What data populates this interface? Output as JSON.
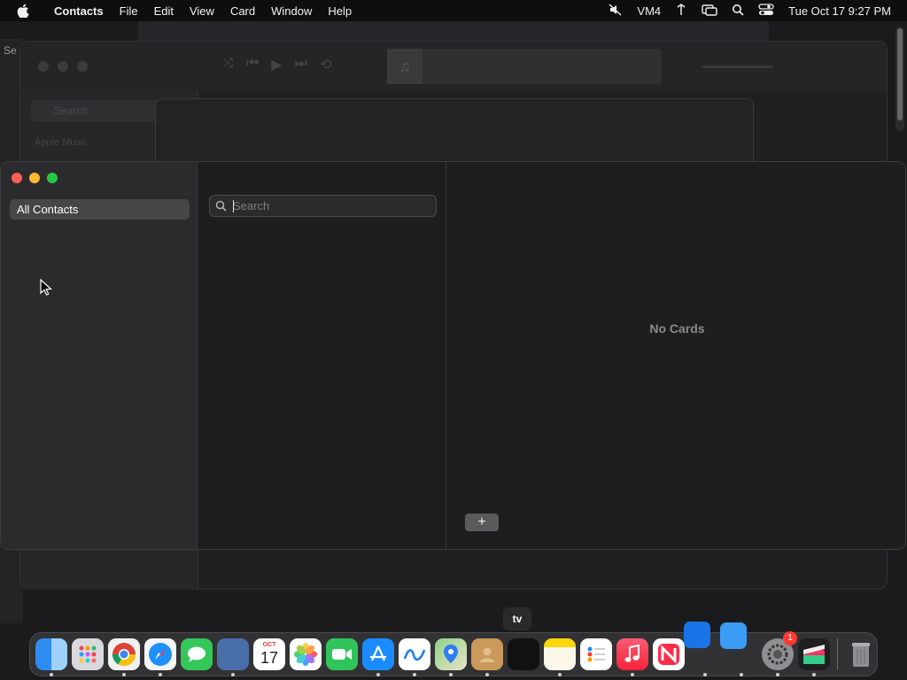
{
  "menubar": {
    "app_name": "Contacts",
    "items": [
      "File",
      "Edit",
      "View",
      "Card",
      "Window",
      "Help"
    ],
    "status_text": "VM4",
    "clock": "Tue Oct 17  9:27 PM"
  },
  "background": {
    "left_window_text": "Se",
    "music_search_placeholder": "Search",
    "music_section": "Apple Music"
  },
  "contacts": {
    "groups": [
      {
        "label": "All Contacts",
        "selected": true
      }
    ],
    "search": {
      "placeholder": "Search",
      "value": ""
    },
    "empty_state": "No Cards",
    "add_button_label": "+"
  },
  "dock": {
    "tv_label": "tv",
    "calendar_month": "OCT",
    "calendar_day": "17",
    "settings_badge": "1",
    "apps": [
      "Finder",
      "Launchpad",
      "Chrome",
      "Safari",
      "Messages",
      "Remote Desktop",
      "Calendar",
      "Photos",
      "FaceTime",
      "App Store",
      "Freeform",
      "Maps",
      "Contacts",
      "Apple TV",
      "Notes",
      "Reminders",
      "Music",
      "News",
      "Keynote",
      "Mail",
      "System Settings",
      "Final Cut Pro",
      "Trash"
    ]
  },
  "colors": {
    "traffic_close": "#ff5f57",
    "traffic_min": "#febc2e",
    "traffic_max": "#28c840",
    "selection": "#464649"
  }
}
